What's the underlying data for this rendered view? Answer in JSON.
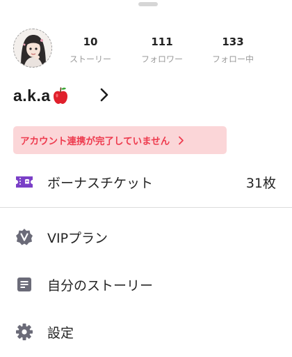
{
  "profile": {
    "username": "a.k.a",
    "username_emoji_icon": "red-apple-icon",
    "avatar_icon": "profile-avatar-illustration"
  },
  "stats": [
    {
      "count": "10",
      "label": "ストーリー"
    },
    {
      "count": "111",
      "label": "フォロワー"
    },
    {
      "count": "133",
      "label": "フォロー中"
    }
  ],
  "alert": {
    "text": "アカウント連携が完了していません",
    "text_color": "#ee3b4e",
    "background_color": "#fbd6d8"
  },
  "menu": {
    "bonus_ticket": {
      "label": "ボーナスチケット",
      "value": "31枚",
      "icon": "ticket-icon",
      "icon_color": "#7a3fc7"
    },
    "vip_plan": {
      "label": "VIPプラン",
      "icon": "vip-badge-icon"
    },
    "my_stories": {
      "label": "自分のストーリー",
      "icon": "document-icon"
    },
    "settings": {
      "label": "設定",
      "icon": "gear-icon"
    }
  }
}
